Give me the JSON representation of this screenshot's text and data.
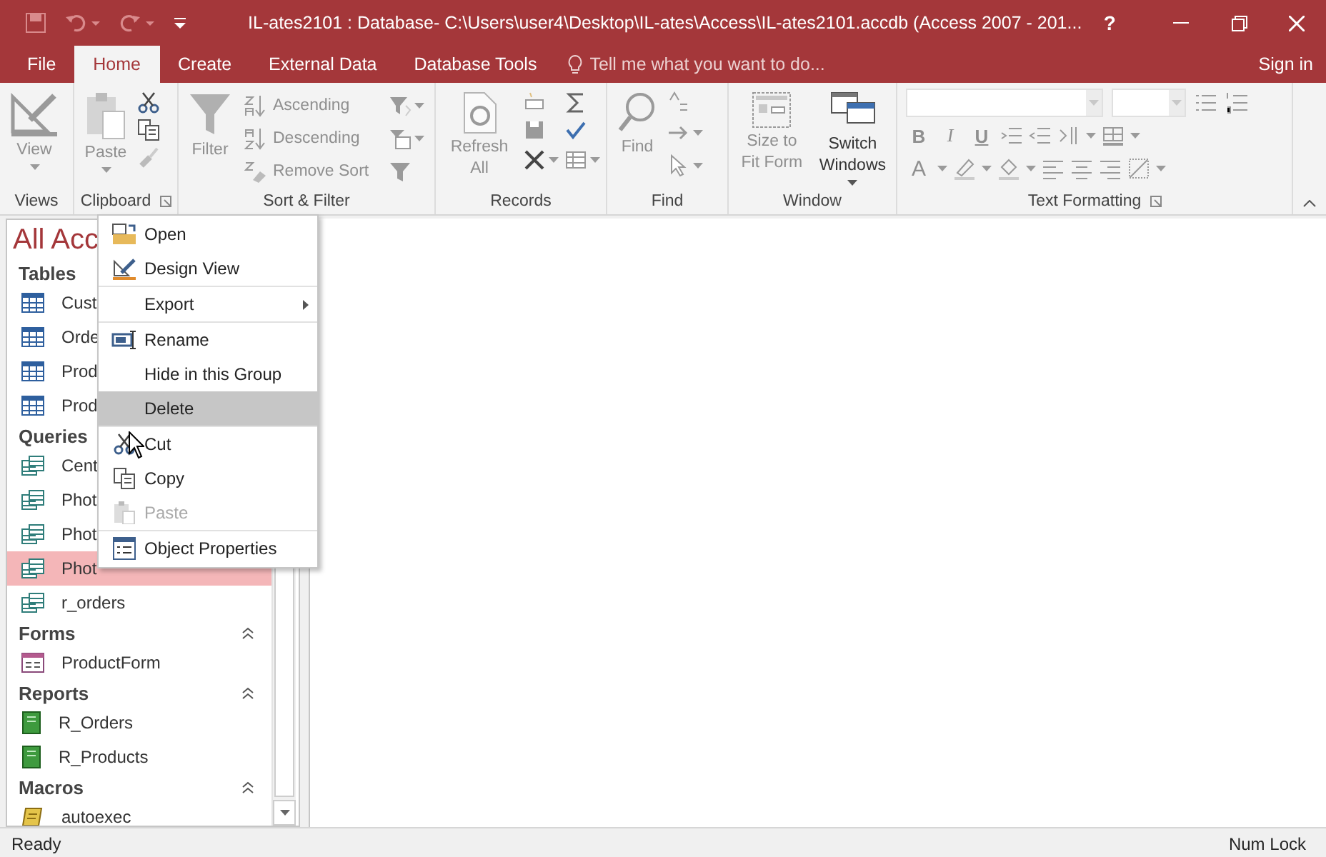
{
  "window": {
    "title": "IL-ates2101 : Database- C:\\Users\\user4\\Desktop\\IL-ates\\Access\\IL-ates2101.accdb (Access 2007 - 201...",
    "help": "?"
  },
  "ribbon_tabs": [
    {
      "label": "File",
      "selected": false
    },
    {
      "label": "Home",
      "selected": true
    },
    {
      "label": "Create",
      "selected": false
    },
    {
      "label": "External Data",
      "selected": false
    },
    {
      "label": "Database Tools",
      "selected": false
    }
  ],
  "tell_me": {
    "placeholder": "Tell me what you want to do..."
  },
  "sign_in": "Sign in",
  "ribbon_groups": [
    {
      "label": "Views",
      "buttons": [
        {
          "label": "View",
          "disabled": true
        }
      ]
    },
    {
      "label": "Clipboard",
      "buttons": [
        {
          "label": "Paste",
          "disabled": true
        }
      ]
    },
    {
      "label": "Sort & Filter",
      "buttons": [
        {
          "label": "Filter",
          "disabled": true
        },
        {
          "label": "Ascending",
          "disabled": true
        },
        {
          "label": "Descending",
          "disabled": true
        },
        {
          "label": "Remove Sort",
          "disabled": true
        }
      ]
    },
    {
      "label": "Records",
      "buttons": [
        {
          "label": "Refresh All",
          "disabled": true
        }
      ]
    },
    {
      "label": "Find",
      "buttons": [
        {
          "label": "Find",
          "disabled": true
        }
      ]
    },
    {
      "label": "Window",
      "buttons": [
        {
          "label": "Size to Fit Form",
          "disabled": true
        },
        {
          "label": "Switch Windows",
          "disabled": false
        }
      ]
    },
    {
      "label": "Text Formatting",
      "letters": [
        "B",
        "I",
        "U",
        "A"
      ]
    }
  ],
  "nav_pane": {
    "title": "All Acc",
    "groups": [
      {
        "label": "Tables",
        "items": [
          {
            "name": "Cust",
            "kind": "table",
            "selected": false
          },
          {
            "name": "Orde",
            "kind": "table",
            "selected": false
          },
          {
            "name": "Prod",
            "kind": "table",
            "selected": false
          },
          {
            "name": "Prod",
            "kind": "table",
            "selected": false
          }
        ]
      },
      {
        "label": "Queries",
        "items": [
          {
            "name": "Cent",
            "kind": "query",
            "selected": false
          },
          {
            "name": "Phot",
            "kind": "query",
            "selected": false
          },
          {
            "name": "Phot",
            "kind": "query",
            "selected": false
          },
          {
            "name": "Phot",
            "kind": "query",
            "selected": true
          },
          {
            "name": "r_orders",
            "kind": "query",
            "selected": false
          }
        ]
      },
      {
        "label": "Forms",
        "expanded": true,
        "items": [
          {
            "name": "ProductForm",
            "kind": "form",
            "selected": false
          }
        ]
      },
      {
        "label": "Reports",
        "expanded": true,
        "items": [
          {
            "name": "R_Orders",
            "kind": "report",
            "selected": false
          },
          {
            "name": "R_Products",
            "kind": "report",
            "selected": false
          }
        ]
      },
      {
        "label": "Macros",
        "expanded": true,
        "items": [
          {
            "name": "autoexec",
            "kind": "macro",
            "selected": false
          }
        ]
      }
    ]
  },
  "context_menu": [
    {
      "label": "Open",
      "kind": "open",
      "submenu": false,
      "separator": false,
      "disabled": false,
      "selected": false
    },
    {
      "label": "Design View",
      "kind": "design",
      "submenu": false,
      "separator": false,
      "disabled": false,
      "selected": false
    },
    {
      "label": "Export",
      "kind": "none",
      "submenu": true,
      "separator": true,
      "disabled": false,
      "selected": false
    },
    {
      "label": "Rename",
      "kind": "rename",
      "submenu": false,
      "separator": true,
      "disabled": false,
      "selected": false
    },
    {
      "label": "Hide in this Group",
      "kind": "none",
      "submenu": false,
      "separator": false,
      "disabled": false,
      "selected": false
    },
    {
      "label": "Delete",
      "kind": "none",
      "submenu": false,
      "separator": false,
      "disabled": false,
      "selected": true
    },
    {
      "label": "Cut",
      "kind": "cut",
      "submenu": false,
      "separator": true,
      "disabled": false,
      "selected": false
    },
    {
      "label": "Copy",
      "kind": "copy",
      "submenu": false,
      "separator": false,
      "disabled": false,
      "selected": false
    },
    {
      "label": "Paste",
      "kind": "paste",
      "submenu": false,
      "separator": false,
      "disabled": true,
      "selected": false
    },
    {
      "label": "Object Properties",
      "kind": "properties",
      "submenu": false,
      "separator": true,
      "disabled": false,
      "selected": false
    }
  ],
  "status_bar": {
    "left": "Ready",
    "right": "Num Lock"
  }
}
